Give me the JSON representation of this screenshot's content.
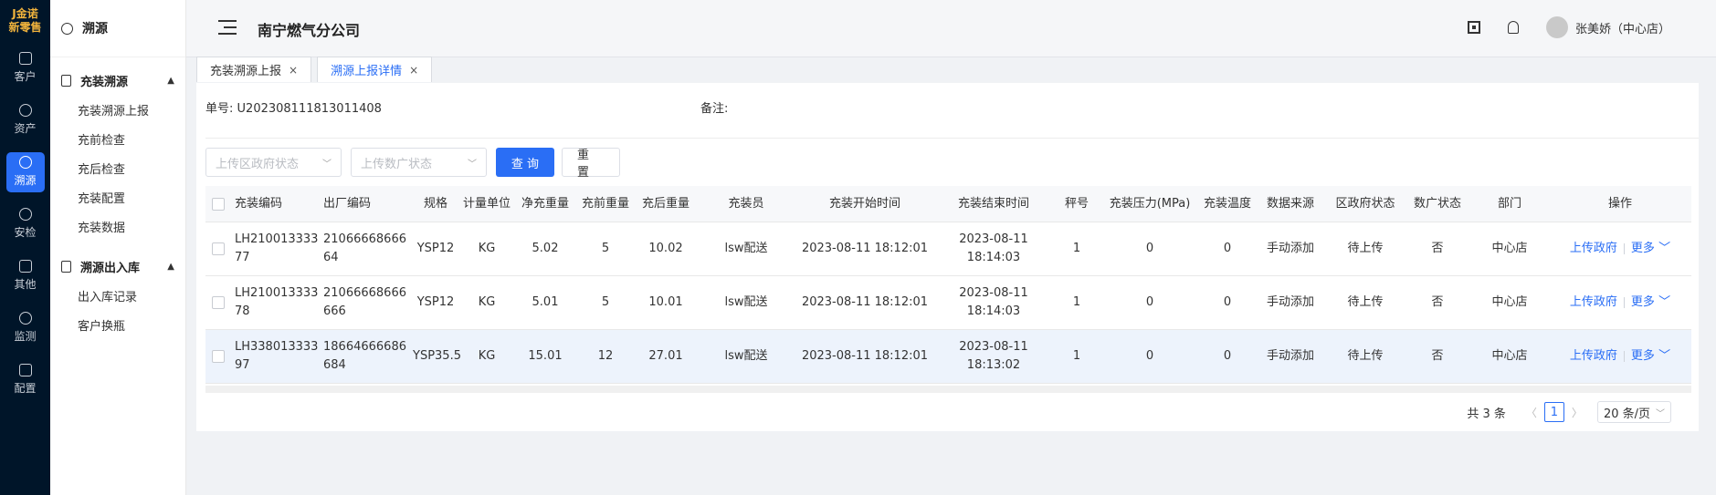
{
  "rail": {
    "logo_line1": "J金诺",
    "logo_line2": "新零售",
    "items": [
      {
        "label": "客户",
        "icon": "customer-card-icon"
      },
      {
        "label": "资产",
        "icon": "lightbulb-icon"
      },
      {
        "label": "溯源",
        "icon": "compass-icon",
        "active": true
      },
      {
        "label": "安检",
        "icon": "shield-icon"
      },
      {
        "label": "其他",
        "icon": "grid-plus-icon"
      },
      {
        "label": "监测",
        "icon": "alarm-icon"
      },
      {
        "label": "配置",
        "icon": "apps-icon"
      }
    ]
  },
  "subnav": {
    "title": "溯源",
    "groups": [
      {
        "label": "充装溯源",
        "items": [
          "充装溯源上报",
          "充前检查",
          "充后检查",
          "充装配置",
          "充装数据"
        ]
      },
      {
        "label": "溯源出入库",
        "items": [
          "出入库记录",
          "客户换瓶"
        ]
      }
    ]
  },
  "header": {
    "company": "南宁燃气分公司",
    "username": "张美娇（中心店）"
  },
  "tabs": [
    {
      "label": "充装溯源上报",
      "close": "×"
    },
    {
      "label": "溯源上报详情",
      "close": "×",
      "active": true
    }
  ],
  "detail": {
    "order_label": "单号:",
    "order_no": "U202308111813011408",
    "remark_label": "备注:"
  },
  "filters": {
    "gov_status_placeholder": "上传区政府状态",
    "digital_status_placeholder": "上传数广状态",
    "query_label": "查 询",
    "reset_label": "重 置"
  },
  "table": {
    "headers": [
      "充装编码",
      "出厂编码",
      "规格",
      "计量单位",
      "净充重量",
      "充前重量",
      "充后重量",
      "充装员",
      "充装开始时间",
      "充装结束时间",
      "秤号",
      "充装压力(MPa)",
      "充装温度",
      "数据来源",
      "区政府状态",
      "数广状态",
      "部门",
      "操作"
    ],
    "rows": [
      [
        "LH21001333377",
        "2106666866664",
        "YSP12",
        "KG",
        "5.02",
        "5",
        "10.02",
        "lsw配送",
        "2023-08-11 18:12:01",
        "2023-08-11 18:14:03",
        "1",
        "0",
        "0",
        "手动添加",
        "待上传",
        "否",
        "中心店"
      ],
      [
        "LH21001333378",
        "21066668666666",
        "YSP12",
        "KG",
        "5.01",
        "5",
        "10.01",
        "lsw配送",
        "2023-08-11 18:12:01",
        "2023-08-11 18:14:03",
        "1",
        "0",
        "0",
        "手动添加",
        "待上传",
        "否",
        "中心店"
      ],
      [
        "LH33801333397",
        "18664666686684",
        "YSP35.5",
        "KG",
        "15.01",
        "12",
        "27.01",
        "lsw配送",
        "2023-08-11 18:12:01",
        "2023-08-11 18:13:02",
        "1",
        "0",
        "0",
        "手动添加",
        "待上传",
        "否",
        "中心店"
      ]
    ],
    "op_upload": "上传政府",
    "op_more": "更多"
  },
  "pager": {
    "total": "共 3 条",
    "current": "1",
    "size": "20 条/页"
  },
  "colors": {
    "accent": "#2a6ef5",
    "rail_bg": "#001529",
    "logo": "#f2b43c"
  }
}
